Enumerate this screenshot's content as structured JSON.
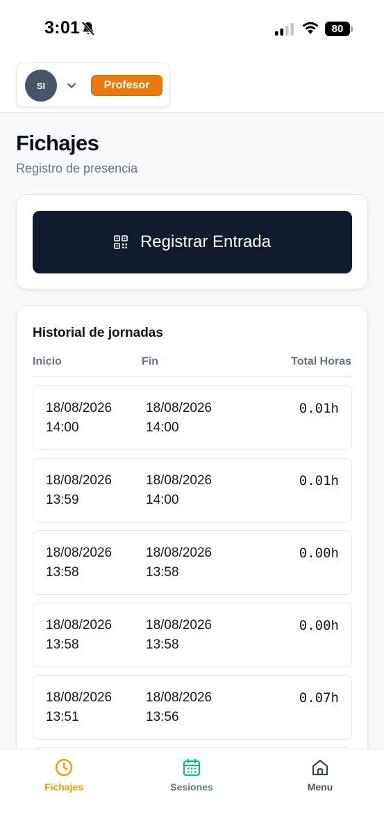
{
  "status_bar": {
    "time": "3:01",
    "battery": "80"
  },
  "header": {
    "avatar_initials": "SI",
    "role_badge": "Profesor"
  },
  "page": {
    "title": "Fichajes",
    "subtitle": "Registro de presencia"
  },
  "register": {
    "button_label": "Registrar Entrada"
  },
  "history": {
    "title": "Historial de jornadas",
    "columns": [
      "Inicio",
      "Fin",
      "Total Horas"
    ],
    "rows": [
      {
        "start_date": "18/08/2026",
        "start_time": "14:00",
        "end_date": "18/08/2026",
        "end_time": "14:00",
        "hours": "0.01h"
      },
      {
        "start_date": "18/08/2026",
        "start_time": "13:59",
        "end_date": "18/08/2026",
        "end_time": "14:00",
        "hours": "0.01h"
      },
      {
        "start_date": "18/08/2026",
        "start_time": "13:58",
        "end_date": "18/08/2026",
        "end_time": "13:58",
        "hours": "0.00h"
      },
      {
        "start_date": "18/08/2026",
        "start_time": "13:58",
        "end_date": "18/08/2026",
        "end_time": "13:58",
        "hours": "0.00h"
      },
      {
        "start_date": "18/08/2026",
        "start_time": "13:51",
        "end_date": "18/08/2026",
        "end_time": "13:56",
        "hours": "0.07h"
      }
    ]
  },
  "nav": {
    "items": [
      {
        "label": "Fichajes",
        "icon": "clock-icon",
        "active": true
      },
      {
        "label": "Sesiones",
        "icon": "calendar-icon",
        "active": false
      },
      {
        "label": "Menu",
        "icon": "home-icon",
        "active": false
      }
    ]
  },
  "colors": {
    "accent_orange": "#ea7a0c",
    "sessions_green": "#10b981",
    "primary_dark": "#121a2e",
    "muted_text": "#64748b"
  }
}
